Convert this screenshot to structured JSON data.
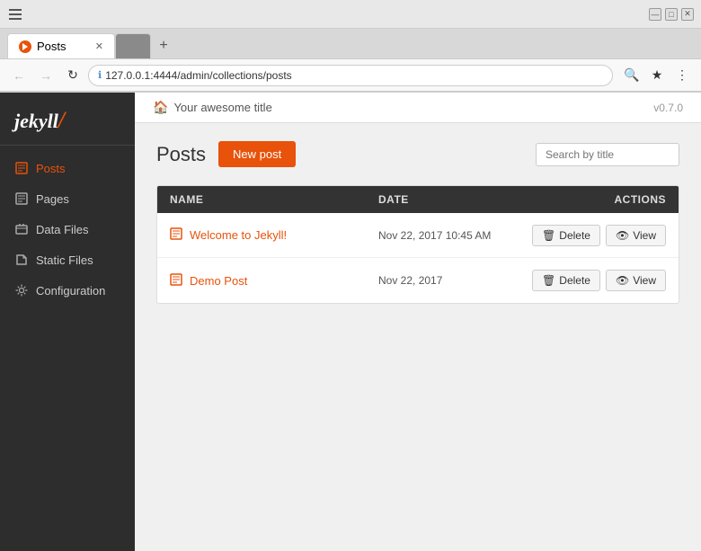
{
  "browser": {
    "title_bar": {
      "app_icon": "☰"
    },
    "tabs": [
      {
        "label": "Posts",
        "active": true,
        "favicon_color": "#e8520a"
      },
      {
        "label": "",
        "active": false
      }
    ],
    "address": "127.0.0.1:4444/admin/collections/posts",
    "address_protocol": "127.0.0.1",
    "address_path": ":4444/admin/collections/posts"
  },
  "window_controls": {
    "minimize": "—",
    "maximize": "□",
    "close": "✕"
  },
  "sidebar": {
    "logo": "jekyll",
    "items": [
      {
        "label": "Posts",
        "icon": "📄",
        "active": true,
        "id": "posts"
      },
      {
        "label": "Pages",
        "icon": "📋",
        "active": false,
        "id": "pages"
      },
      {
        "label": "Data Files",
        "icon": "📊",
        "active": false,
        "id": "data-files"
      },
      {
        "label": "Static Files",
        "icon": "📁",
        "active": false,
        "id": "static-files"
      },
      {
        "label": "Configuration",
        "icon": "⚙",
        "active": false,
        "id": "configuration"
      }
    ]
  },
  "top_bar": {
    "breadcrumb_home": "🏠",
    "breadcrumb_title": "Your awesome title",
    "version": "v0.7.0"
  },
  "main": {
    "page_title": "Posts",
    "new_post_label": "New post",
    "search_placeholder": "Search by title",
    "table": {
      "headers": [
        "NAME",
        "DATE",
        "ACTIONS"
      ],
      "rows": [
        {
          "name": "Welcome to Jekyll!",
          "date": "Nov 22, 2017 10:45 AM",
          "actions": [
            "Delete",
            "View"
          ]
        },
        {
          "name": "Demo Post",
          "date": "Nov 22, 2017",
          "actions": [
            "Delete",
            "View"
          ]
        }
      ]
    }
  },
  "colors": {
    "accent": "#e8520a",
    "sidebar_bg": "#2d2d2d",
    "header_bg": "#333333"
  }
}
